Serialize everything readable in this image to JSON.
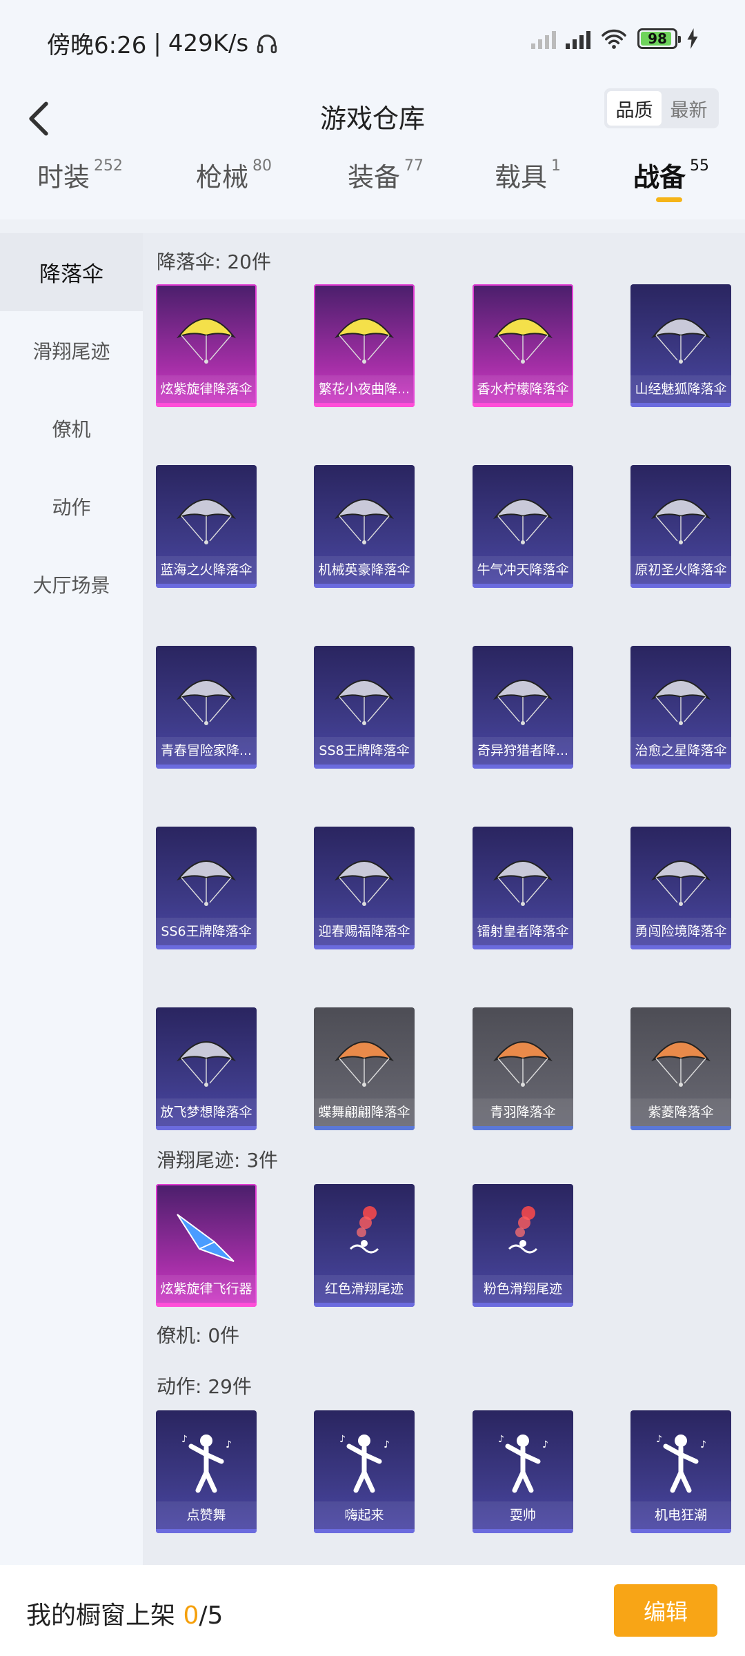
{
  "status": {
    "time": "傍晚6:26",
    "speed": "429K/s",
    "battery": "98"
  },
  "header": {
    "title": "游戏仓库",
    "sort": [
      "品质",
      "最新"
    ]
  },
  "tabs": [
    {
      "label": "时装",
      "count": "252"
    },
    {
      "label": "枪械",
      "count": "80"
    },
    {
      "label": "装备",
      "count": "77"
    },
    {
      "label": "载具",
      "count": "1"
    },
    {
      "label": "战备",
      "count": "55"
    }
  ],
  "sidebar": [
    "降落伞",
    "滑翔尾迹",
    "僚机",
    "动作",
    "大厅场景"
  ],
  "sections": {
    "parachute": {
      "title": "降落伞: 20件",
      "items": [
        {
          "name": "炫紫旋律降落伞",
          "tier": "pink",
          "icon": "parachute-icon"
        },
        {
          "name": "繁花小夜曲降...",
          "tier": "pink",
          "icon": "parachute-icon"
        },
        {
          "name": "香水柠檬降落伞",
          "tier": "pink",
          "icon": "parachute-icon"
        },
        {
          "name": "山经魅狐降落伞",
          "tier": "purple",
          "icon": "parachute-icon"
        },
        {
          "name": "蓝海之火降落伞",
          "tier": "purple",
          "icon": "parachute-icon"
        },
        {
          "name": "机械英豪降落伞",
          "tier": "purple",
          "icon": "parachute-icon"
        },
        {
          "name": "牛气冲天降落伞",
          "tier": "purple",
          "icon": "parachute-icon"
        },
        {
          "name": "原初圣火降落伞",
          "tier": "purple",
          "icon": "parachute-icon"
        },
        {
          "name": "青春冒险家降...",
          "tier": "purple",
          "icon": "parachute-icon"
        },
        {
          "name": "SS8王牌降落伞",
          "tier": "purple",
          "icon": "parachute-icon"
        },
        {
          "name": "奇异狩猎者降...",
          "tier": "purple",
          "icon": "parachute-icon"
        },
        {
          "name": "治愈之星降落伞",
          "tier": "purple",
          "icon": "parachute-icon"
        },
        {
          "name": "SS6王牌降落伞",
          "tier": "purple",
          "icon": "parachute-icon"
        },
        {
          "name": "迎春赐福降落伞",
          "tier": "purple",
          "icon": "parachute-icon"
        },
        {
          "name": "镭射皇者降落伞",
          "tier": "purple",
          "icon": "parachute-icon"
        },
        {
          "name": "勇闯险境降落伞",
          "tier": "purple",
          "icon": "parachute-icon"
        },
        {
          "name": "放飞梦想降落伞",
          "tier": "purple",
          "icon": "parachute-icon"
        },
        {
          "name": "蝶舞翩翩降落伞",
          "tier": "gray",
          "icon": "parachute-icon"
        },
        {
          "name": "青羽降落伞",
          "tier": "gray",
          "icon": "parachute-icon"
        },
        {
          "name": "紫菱降落伞",
          "tier": "gray",
          "icon": "parachute-icon"
        }
      ]
    },
    "trail": {
      "title": "滑翔尾迹: 3件",
      "items": [
        {
          "name": "炫紫旋律飞行器",
          "tier": "pink",
          "icon": "glider-icon"
        },
        {
          "name": "红色滑翔尾迹",
          "tier": "purple",
          "icon": "smoke-trail-icon"
        },
        {
          "name": "粉色滑翔尾迹",
          "tier": "purple",
          "icon": "smoke-trail-icon"
        }
      ]
    },
    "wingman": {
      "title": "僚机: 0件"
    },
    "emote": {
      "title": "动作: 29件",
      "items": [
        {
          "name": "点赞舞",
          "tier": "purple",
          "icon": "dance-pose-icon"
        },
        {
          "name": "嗨起来",
          "tier": "purple",
          "icon": "dance-pose-icon"
        },
        {
          "name": "耍帅",
          "tier": "purple",
          "icon": "dance-pose-icon"
        },
        {
          "name": "机电狂潮",
          "tier": "purple",
          "icon": "dance-pose-icon"
        }
      ]
    }
  },
  "footer": {
    "prefix": "我的橱窗上架 ",
    "current": "0",
    "suffix": "/5",
    "edit": "编辑"
  },
  "colors": {
    "accent": "#f8a516",
    "pink_tier": "#d23cc8",
    "purple_tier": "#3d3a86",
    "gray_tier": "#6a6a74"
  }
}
